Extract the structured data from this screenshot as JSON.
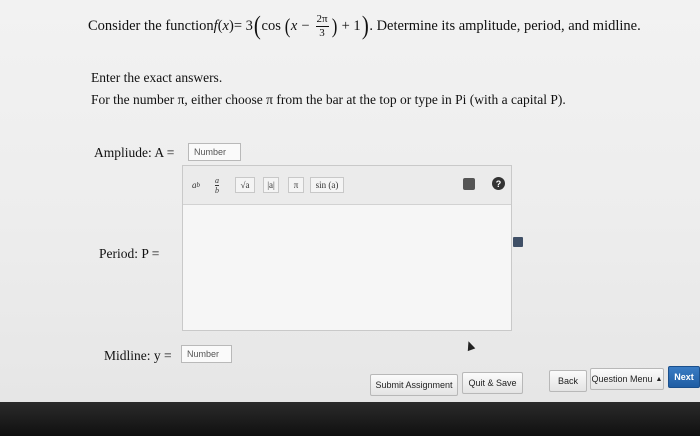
{
  "question": {
    "prefix": "Consider the function ",
    "func_name": "f",
    "func_var": "x",
    "equals_coef": " = 3",
    "cos": "cos",
    "inner_var": "x",
    "minus": "−",
    "frac_num": "2π",
    "frac_den": "3",
    "plus_one": "+ 1",
    "suffix": ". Determine its amplitude, period, and midline."
  },
  "instructions": {
    "line1": "Enter the exact answers.",
    "line2": "For the number π, either choose π from the bar at the top or type in Pi (with a capital P)."
  },
  "amplitude": {
    "label": "Ampliude: A =",
    "placeholder": "Number"
  },
  "period": {
    "label": "Period: P ="
  },
  "midline": {
    "label": "Midline: y =",
    "placeholder": "Number"
  },
  "toolbar": {
    "power": "a",
    "power_sup": "b",
    "fraction_num": "a",
    "fraction_den": "b",
    "sqrt": "√a",
    "abs": "|a|",
    "pi": "π",
    "sin": "sin (a)",
    "help": "?"
  },
  "buttons": {
    "submit": "Submit Assignment",
    "quit": "Quit & Save",
    "back": "Back",
    "menu": "Question Menu",
    "menu_caret": "▲",
    "next": "Next"
  }
}
